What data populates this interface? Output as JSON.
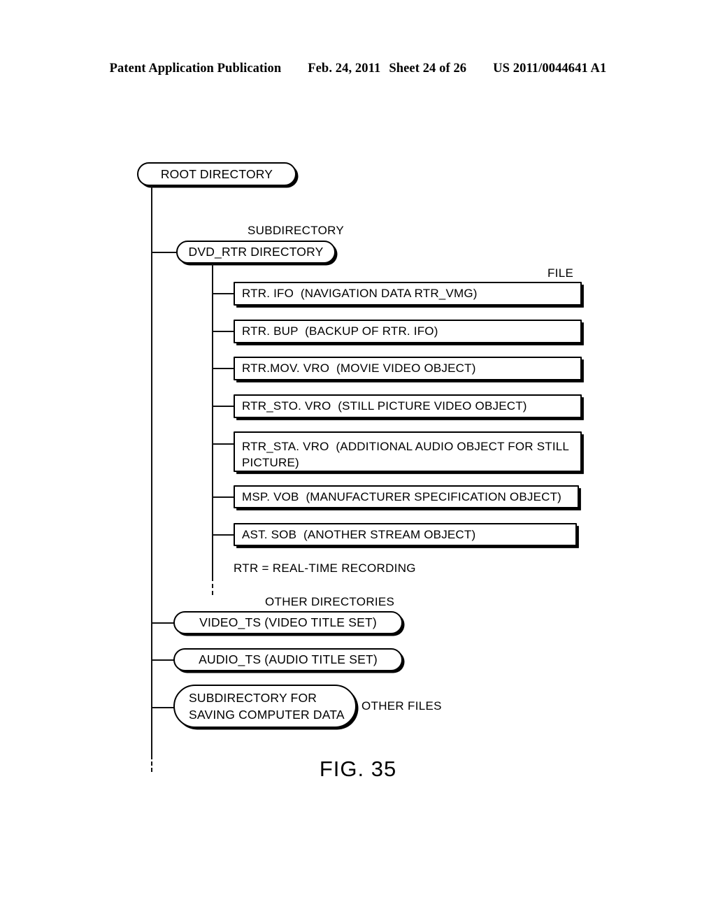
{
  "header": {
    "publication": "Patent Application Publication",
    "date": "Feb. 24, 2011",
    "sheet": "Sheet 24 of 26",
    "patent_number": "US 2011/0044641 A1"
  },
  "figure": {
    "caption": "FIG. 35"
  },
  "diagram": {
    "root": {
      "label": "ROOT DIRECTORY"
    },
    "subdirectory_label": "SUBDIRECTORY",
    "dvd_rtr": {
      "label": "DVD_RTR DIRECTORY"
    },
    "file_label": "FILE",
    "files": [
      {
        "text": "RTR. IFO  (NAVIGATION DATA RTR_VMG)"
      },
      {
        "text": "RTR. BUP  (BACKUP OF RTR. IFO)"
      },
      {
        "text": "RTR.MOV. VRO  (MOVIE VIDEO OBJECT)"
      },
      {
        "text": "RTR_STO. VRO  (STILL PICTURE VIDEO OBJECT)"
      },
      {
        "text": "RTR_STA. VRO  (ADDITIONAL AUDIO OBJECT FOR STILL\nPICTURE)"
      },
      {
        "text": "MSP. VOB  (MANUFACTURER SPECIFICATION OBJECT)"
      },
      {
        "text": "AST. SOB  (ANOTHER STREAM OBJECT)"
      }
    ],
    "note": "RTR = REAL-TIME RECORDING",
    "other_directories_label": "OTHER DIRECTORIES",
    "other_directories": [
      {
        "label": "VIDEO_TS (VIDEO TITLE SET)"
      },
      {
        "label": "AUDIO_TS (AUDIO TITLE SET)"
      }
    ],
    "computer_data_dir": {
      "line1": "SUBDIRECTORY FOR",
      "line2": "SAVING COMPUTER DATA"
    },
    "other_files_label": "OTHER FILES"
  },
  "colors": {
    "ink": "#000000",
    "paper": "#ffffff"
  }
}
